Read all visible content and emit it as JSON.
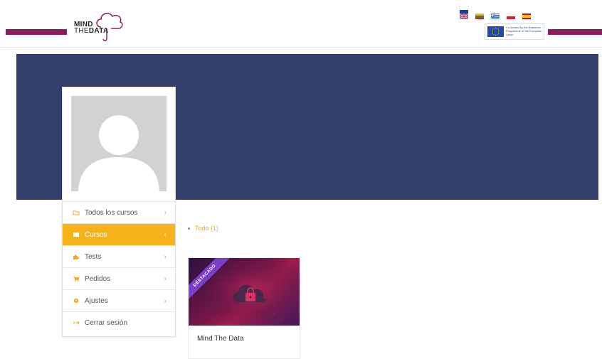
{
  "header": {
    "logo_line1": "MIND",
    "logo_line2_a": "THE",
    "logo_line2_b": "DATA",
    "eu_text": "Co-funded by the Erasmus+ Programme of the European Union",
    "flags": [
      {
        "name": "flag-uk-icon",
        "color": "#1c3f94"
      },
      {
        "name": "flag-lithuania-icon",
        "color": "#2a8c3a"
      },
      {
        "name": "flag-greece-icon",
        "color": "#3a6fc4"
      },
      {
        "name": "flag-poland-icon",
        "color": "#dc1c35"
      },
      {
        "name": "flag-spain-icon",
        "color": "#e8a200"
      }
    ],
    "accent_color": "#8e1d5a"
  },
  "banner": {
    "color": "#353f6b"
  },
  "menu": {
    "items": [
      {
        "label": "Todos los cursos",
        "icon": "folder-icon",
        "chevron": "›",
        "active": false
      },
      {
        "label": "Cursos",
        "icon": "book-icon",
        "chevron": "‹",
        "active": true
      },
      {
        "label": "Tests",
        "icon": "puzzle-icon",
        "chevron": "›",
        "active": false
      },
      {
        "label": "Pedidos",
        "icon": "cart-icon",
        "chevron": "›",
        "active": false
      },
      {
        "label": "Ajustes",
        "icon": "gear-icon",
        "chevron": "›",
        "active": false
      },
      {
        "label": "Cerrar sesión",
        "icon": "logout-icon",
        "chevron": "",
        "active": false
      }
    ],
    "active_color": "#f5b21b"
  },
  "filter": {
    "label": "Todo (1)"
  },
  "course": {
    "ribbon": "DESTACADO",
    "title": "Mind The Data"
  }
}
